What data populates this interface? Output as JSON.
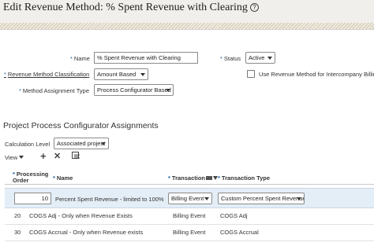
{
  "header": {
    "title": "Edit Revenue Method: % Spent Revenue with Clearing",
    "help_icon": "question-circle-icon"
  },
  "form": {
    "name_label": "Name",
    "name_value": "% Spent Revenue with Clearing",
    "status_label": "Status",
    "status_value": "Active",
    "classification_label": "Revenue Method Classification",
    "classification_value": "Amount Based",
    "intercompany_label": "Use Revenue Method for Intercompany Billing",
    "intercompany_checked": false,
    "assignment_type_label": "Method Assignment Type",
    "assignment_type_value": "Process Configurator Based",
    "required_mark": "*"
  },
  "assignments": {
    "title": "Project Process Configurator Assignments",
    "calc_level_label": "Calculation Level",
    "calc_level_value": "Associated project",
    "toolbar": {
      "view_label": "View",
      "add_icon": "plus-icon",
      "delete_icon": "x-icon",
      "detach_icon": "detach-icon"
    },
    "columns": {
      "processing_order_line1": "Processing",
      "processing_order_line2": "Order",
      "name": "Name",
      "transaction": "Transaction",
      "transaction_type": "Transaction Type"
    },
    "rows": [
      {
        "order": "10",
        "name": "Percent Spent Revenue - limited to 100%",
        "transaction": "Billing Event",
        "transaction_type": "Custom Percent Spent Revenue"
      },
      {
        "order": "20",
        "name": "COGS Adj - Only when Revenue Exists",
        "transaction": "Billing Event",
        "transaction_type": "COGS Adj"
      },
      {
        "order": "30",
        "name": "COGS Accrual - Only when Revenue exists",
        "transaction": "Billing Event",
        "transaction_type": "COGS Accrual"
      }
    ]
  }
}
